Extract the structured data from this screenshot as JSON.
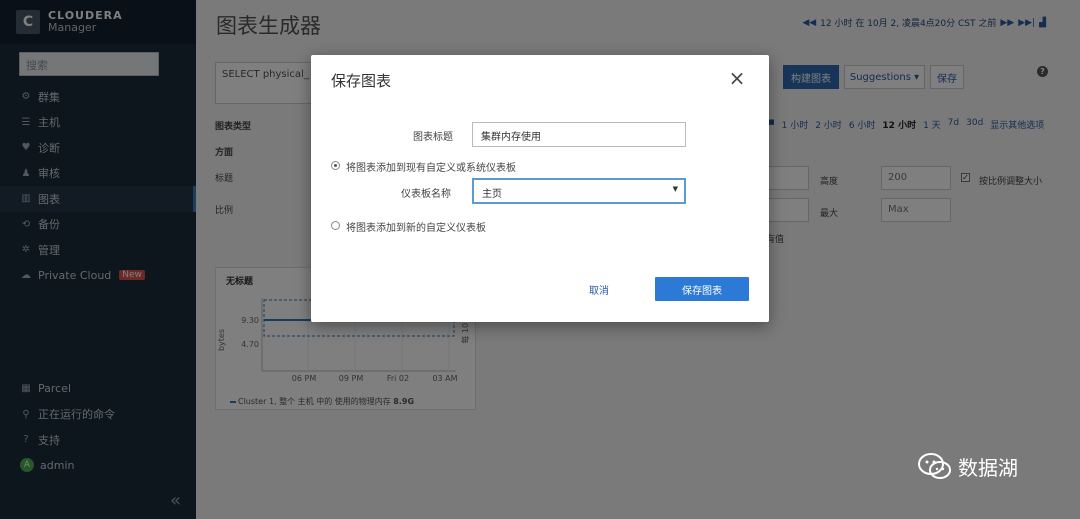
{
  "sidebar": {
    "brand_line1": "CLOUDERA",
    "brand_line2": "Manager",
    "logo_letter": "C",
    "search_placeholder": "搜索",
    "items": [
      {
        "label": "群集",
        "icon": "cluster-icon",
        "glyph": "⚙"
      },
      {
        "label": "主机",
        "icon": "hosts-icon",
        "glyph": "☰"
      },
      {
        "label": "诊断",
        "icon": "heart-icon",
        "glyph": "♥"
      },
      {
        "label": "审核",
        "icon": "audit-icon",
        "glyph": "♟"
      },
      {
        "label": "图表",
        "icon": "chart-icon",
        "glyph": "▥"
      },
      {
        "label": "备份",
        "icon": "backup-icon",
        "glyph": "⟲"
      },
      {
        "label": "管理",
        "icon": "gear-icon",
        "glyph": "✲"
      },
      {
        "label": "Private Cloud",
        "icon": "cloud-icon",
        "glyph": "☁",
        "badge": "New"
      }
    ],
    "bottom_items": [
      {
        "label": "Parcel",
        "icon": "parcel-icon",
        "glyph": "▦"
      },
      {
        "label": "正在运行的命令",
        "icon": "commands-icon",
        "glyph": "⚲"
      },
      {
        "label": "支持",
        "icon": "help-icon",
        "glyph": "?"
      },
      {
        "label": "admin",
        "icon": "user-avatar-icon",
        "glyph": "A"
      }
    ],
    "collapse_glyph": "«"
  },
  "main": {
    "page_title": "图表生成器",
    "time_range": "12 小时 在 10月 2, 凌晨4点20分 CST 之前",
    "query_text": "SELECT physical_",
    "build_button": "构建图表",
    "suggestions_button": "Suggestions ▾",
    "save_button": "保存",
    "chart_type_label": "图表类型",
    "facet_label": "方面",
    "title_label": "标题",
    "scale_label": "比例",
    "range_links": [
      "1 小时",
      "2 小时",
      "6 小时",
      "12 小时",
      "1 天",
      "7d",
      "30d",
      "显示其他选项"
    ],
    "range_prefix": "■",
    "current_range": "12 小时",
    "height_label": "高度",
    "height_value": "200",
    "max_label": "最大",
    "max_placeholder": "Max",
    "scale_proportional_label": "按比例调整大小",
    "all_label": "有值",
    "chart": {
      "title": "无标题",
      "ylabel": "bytes",
      "yticks": [
        "9.30",
        "4.70"
      ],
      "xticks": [
        "06 PM",
        "09 PM",
        "Fri 02",
        "03 AM"
      ],
      "side_text": "每 10 分",
      "legend": "Cluster 1, 整个 主机 中的 使用的物理内存",
      "legend_value": "8.9G",
      "series_color": "#2c7bbf"
    }
  },
  "modal": {
    "title": "保存图表",
    "close": "×",
    "chart_title_label": "图表标题",
    "chart_title_value": "集群内存使用",
    "radio_existing": "将图表添加到现有自定义或系统仪表板",
    "dashboard_name_label": "仪表板名称",
    "dashboard_name_value": "主页",
    "radio_new": "将图表添加到新的自定义仪表板",
    "cancel": "取消",
    "save": "保存图表"
  },
  "watermark": {
    "text": "数据湖"
  }
}
